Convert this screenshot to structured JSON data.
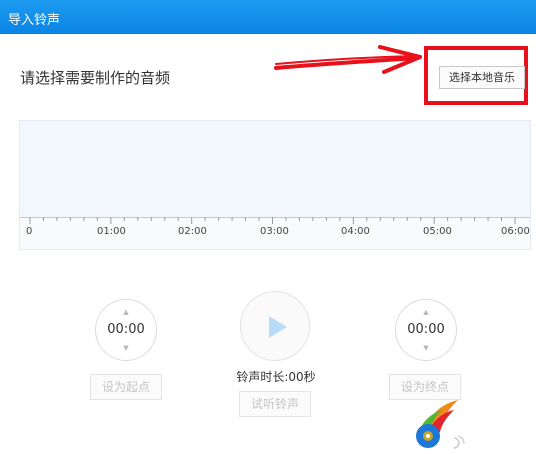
{
  "window": {
    "title": "导入铃声"
  },
  "main": {
    "prompt": "请选择需要制作的音频",
    "select_button": "选择本地音乐"
  },
  "timeline": {
    "ticks": [
      "0",
      "01:00",
      "02:00",
      "03:00",
      "04:00",
      "05:00",
      "06:00"
    ]
  },
  "controls": {
    "start_time": "00:00",
    "end_time": "00:00",
    "set_start_label": "设为起点",
    "set_end_label": "设为终点",
    "duration_text": "铃声时长:00秒",
    "preview_label": "试听铃声"
  },
  "colors": {
    "titlebar": "#0a84e6",
    "highlight": "#e8101a",
    "play_icon": "#b9dcf8"
  },
  "icons": {
    "play": "play-icon",
    "spinner_up": "chevron-up-icon",
    "spinner_down": "chevron-down-icon",
    "watermark": "app-logo-icon"
  }
}
